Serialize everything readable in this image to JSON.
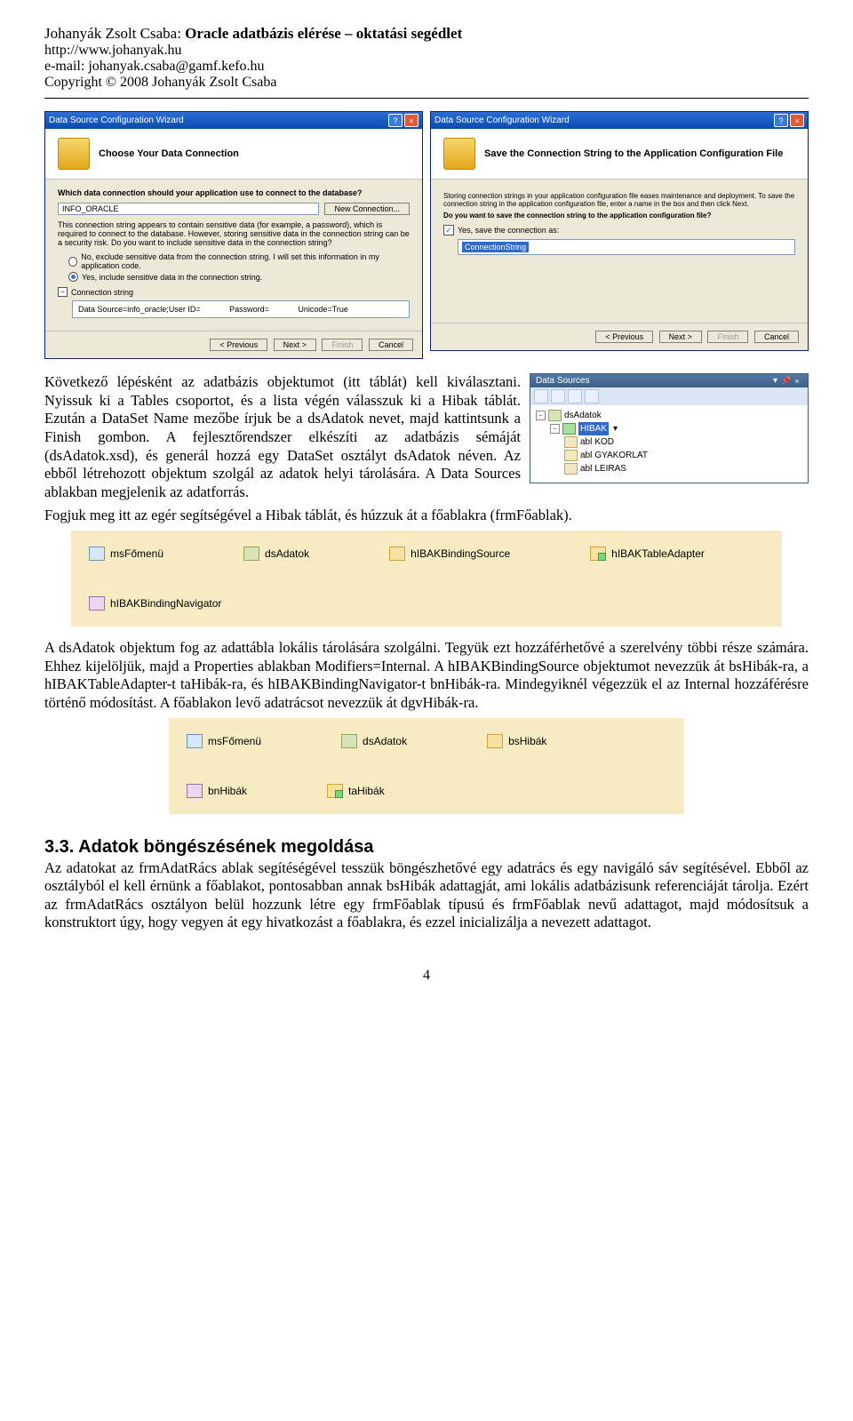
{
  "header": {
    "author": "Johanyák Zsolt Csaba:",
    "title": "Oracle adatbázis elérése – oktatási segédlet",
    "url": "http://www.johanyak.hu",
    "email_label": "e-mail: johanyak.csaba@gamf.kefo.hu",
    "copyright": "Copyright © 2008 Johanyák Zsolt Csaba"
  },
  "wizard1": {
    "title": "Data Source Configuration Wizard",
    "heading": "Choose Your Data Connection",
    "question": "Which data connection should your application use to connect to the database?",
    "combo_value": "INFO_ORACLE",
    "new_conn": "New Connection...",
    "note": "This connection string appears to contain sensitive data (for example, a password), which is required to connect to the database. However, storing sensitive data in the connection string can be a security risk. Do you want to include sensitive data in the connection string?",
    "radio_no": "No, exclude sensitive data from the connection string. I will set this information in my application code.",
    "radio_yes": "Yes, include sensitive data in the connection string.",
    "expand_label": "Connection string",
    "cs_ds": "Data Source=info_oracle;User ID=",
    "cs_pw": "Password=",
    "cs_uc": "Unicode=True",
    "btn_prev": "< Previous",
    "btn_next": "Next >",
    "btn_finish": "Finish",
    "btn_cancel": "Cancel"
  },
  "wizard2": {
    "title": "Data Source Configuration Wizard",
    "heading": "Save the Connection String to the Application Configuration File",
    "desc": "Storing connection strings in your application configuration file eases maintenance and deployment. To save the connection string in the application configuration file, enter a name in the box and then click Next.",
    "q": "Do you want to save the connection string to the application configuration file?",
    "check_label": "Yes, save the connection as:",
    "sel_value": "ConnectionString",
    "btn_prev": "< Previous",
    "btn_next": "Next >",
    "btn_finish": "Finish",
    "btn_cancel": "Cancel"
  },
  "para1_text": "Következő lépésként az adatbázis objektumot (itt táblát) kell kiválasztani. Nyissuk ki a Tables csoportot, és a lista végén válasszuk ki a Hibak táblát. Ezután a DataSet Name mezőbe írjuk be a dsAdatok nevet, majd kattintsunk a Finish gombon. A fejlesztőrendszer elkészíti az adatbázis sémáját (dsAdatok.xsd), és generál hozzá egy DataSet osztályt dsAdatok néven. Az ebből létrehozott objektum szolgál az adatok helyi tárolására. A Data Sources ablakban megjelenik az adatforrás.",
  "para1_tail": "Fogjuk meg itt az egér segítségével a Hibak táblát, és húzzuk át a főablakra (frmFőablak).",
  "ds_panel": {
    "title": "Data Sources",
    "root": "dsAdatok",
    "table": "HIBAK",
    "cols": [
      "KOD",
      "GYAKORLAT",
      "LEIRAS"
    ],
    "col_prefix": "abl"
  },
  "tray1": {
    "items": [
      "msFőmenü",
      "dsAdatok",
      "hIBAKBindingSource",
      "hIBAKTableAdapter",
      "hIBAKBindingNavigator"
    ],
    "icons": [
      "ico-menu",
      "ico-dset",
      "ico-bs",
      "ico-ta",
      "ico-bn"
    ]
  },
  "para2": "A dsAdatok objektum fog az adattábla lokális tárolására szolgálni. Tegyük ezt hozzáférhetővé a szerelvény többi része számára. Ehhez kijelöljük, majd a Properties ablakban Modifiers=Internal. A hIBAKBindingSource objektumot nevezzük át bsHibák-ra, a hIBAKTableAdapter-t taHibák-ra, és hIBAKBindingNavigator-t bnHibák-ra. Mindegyiknél végezzük el az Internal hozzáférésre történő módosítást. A főablakon levő adatrácsot nevezzük át dgvHibák-ra.",
  "tray2": {
    "items": [
      "msFőmenü",
      "dsAdatok",
      "bsHibák",
      "bnHibák",
      "taHibák"
    ],
    "icons": [
      "ico-menu",
      "ico-dset",
      "ico-bs",
      "ico-bn",
      "ico-ta"
    ]
  },
  "section33": {
    "heading": "3.3. Adatok böngészésének megoldása",
    "body": "Az adatokat az frmAdatRács ablak segítéségével tesszük böngészhetővé egy adatrács és egy navigáló sáv segítésével. Ebből az osztályból el kell érnünk a főablakot, pontosabban annak bsHibák adattagját, ami lokális adatbázisunk referenciáját tárolja. Ezért az frmAdatRács osztályon belül hozzunk létre egy frmFőablak típusú és frmFőablak nevű adattagot, majd módosítsuk a konstruktort úgy, hogy vegyen át egy hivatkozást a főablakra, és ezzel inicializálja a nevezett adattagot."
  },
  "page_number": "4"
}
